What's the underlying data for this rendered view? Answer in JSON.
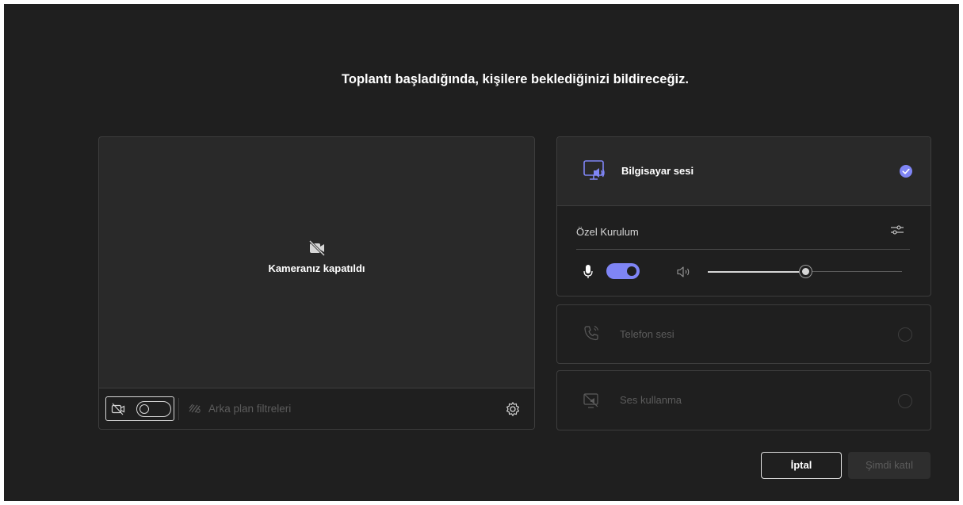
{
  "headline": "Toplantı başladığında, kişilere beklediğinizi bildireceğiz.",
  "preview": {
    "camera_off_text": "Kameranız kapatıldı",
    "background_filters_label": "Arka plan filtreleri",
    "camera_toggle_on": false
  },
  "audio": {
    "computer": {
      "label": "Bilgisayar sesi",
      "selected": true,
      "custom_setup_label": "Özel Kurulum",
      "mic_on": true,
      "speaker_volume": 0.5
    },
    "phone": {
      "label": "Telefon sesi",
      "selected": false
    },
    "no_audio": {
      "label": "Ses kullanma",
      "selected": false
    }
  },
  "buttons": {
    "cancel": "İptal",
    "join_now": "Şimdi katıl"
  },
  "colors": {
    "accent": "#7f85f5",
    "background": "#1f1f1f",
    "surface": "#292929"
  }
}
